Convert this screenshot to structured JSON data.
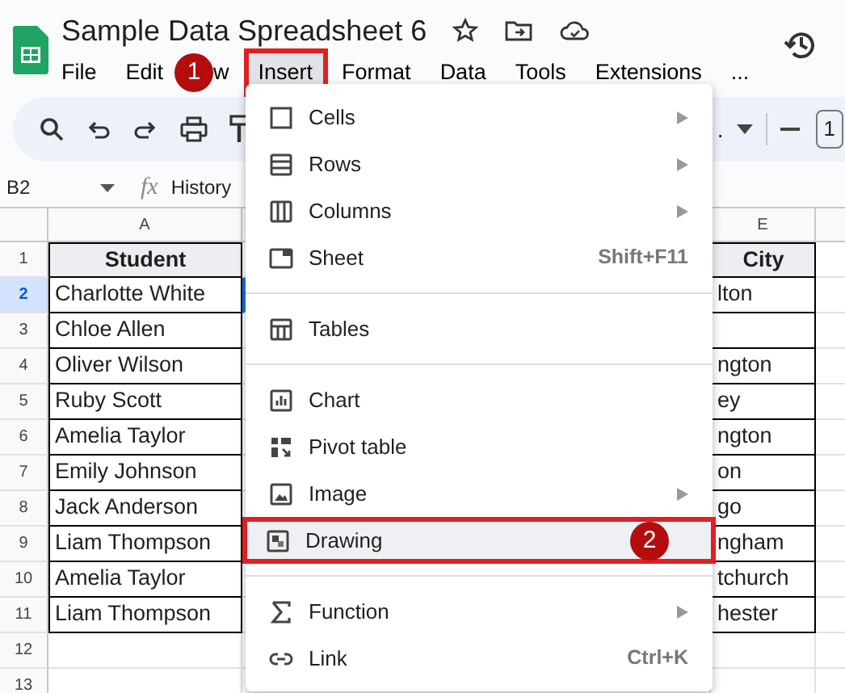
{
  "app": {
    "title": "Sample Data Spreadsheet 6"
  },
  "menubar": [
    {
      "label": "File",
      "selected": false,
      "annotated": false
    },
    {
      "label": "Edit",
      "selected": false,
      "annotated": false
    },
    {
      "label": "w",
      "selected": false,
      "annotated": false,
      "badge": "1"
    },
    {
      "label": "Insert",
      "selected": true,
      "annotated": true
    },
    {
      "label": "Format",
      "selected": false,
      "annotated": false
    },
    {
      "label": "Data",
      "selected": false,
      "annotated": false
    },
    {
      "label": "Tools",
      "selected": false,
      "annotated": false
    },
    {
      "label": "Extensions",
      "selected": false,
      "annotated": false
    },
    {
      "label": "...",
      "selected": false,
      "annotated": false
    }
  ],
  "toolbar": {
    "overflow": ".",
    "zoom": "1"
  },
  "formula_bar": {
    "cell_ref": "B2",
    "fx": "fx",
    "value": "History"
  },
  "grid": {
    "columns": [
      "A",
      "E"
    ],
    "rows": [
      {
        "num": "1",
        "selected": false,
        "header": true,
        "a": "Student",
        "e": "City"
      },
      {
        "num": "2",
        "selected": true,
        "header": false,
        "a": "Charlotte White",
        "e": "lton"
      },
      {
        "num": "3",
        "selected": false,
        "header": false,
        "a": "Chloe Allen"
      },
      {
        "num": "4",
        "selected": false,
        "header": false,
        "a": "Oliver Wilson",
        "e": "ngton"
      },
      {
        "num": "5",
        "selected": false,
        "header": false,
        "a": "Ruby Scott",
        "e": "ey"
      },
      {
        "num": "6",
        "selected": false,
        "header": false,
        "a": "Amelia Taylor",
        "e": "ngton"
      },
      {
        "num": "7",
        "selected": false,
        "header": false,
        "a": "Emily Johnson",
        "e": "on"
      },
      {
        "num": "8",
        "selected": false,
        "header": false,
        "a": "Jack Anderson",
        "e": "go"
      },
      {
        "num": "9",
        "selected": false,
        "header": false,
        "a": "Liam Thompson",
        "e": "ngham"
      },
      {
        "num": "10",
        "selected": false,
        "header": false,
        "a": "Amelia Taylor",
        "e": "tchurch"
      },
      {
        "num": "11",
        "selected": false,
        "header": false,
        "a": "Liam Thompson",
        "e": "hester"
      },
      {
        "num": "12",
        "selected": false,
        "header": false
      },
      {
        "num": "13",
        "selected": false,
        "header": false
      }
    ]
  },
  "insert_menu": [
    {
      "kind": "item",
      "label": "Cells",
      "submenu": true,
      "annotated": false
    },
    {
      "kind": "item",
      "label": "Rows",
      "submenu": true,
      "annotated": false
    },
    {
      "kind": "item",
      "label": "Columns",
      "submenu": true,
      "annotated": false
    },
    {
      "kind": "item",
      "label": "Sheet",
      "shortcut": "Shift+F11",
      "submenu": false,
      "annotated": false
    },
    {
      "kind": "divider"
    },
    {
      "kind": "item",
      "label": "Tables",
      "submenu": false,
      "annotated": false
    },
    {
      "kind": "divider"
    },
    {
      "kind": "item",
      "label": "Chart",
      "submenu": false,
      "annotated": false
    },
    {
      "kind": "item",
      "label": "Pivot table",
      "submenu": false,
      "annotated": false
    },
    {
      "kind": "item",
      "label": "Image",
      "submenu": true,
      "annotated": false
    },
    {
      "kind": "item",
      "label": "Drawing",
      "submenu": false,
      "annotated": true,
      "badge": "2"
    },
    {
      "kind": "divider"
    },
    {
      "kind": "item",
      "label": "Function",
      "submenu": true,
      "annotated": false
    },
    {
      "kind": "item",
      "label": "Link",
      "shortcut": "Ctrl+K",
      "submenu": false,
      "annotated": false
    }
  ]
}
